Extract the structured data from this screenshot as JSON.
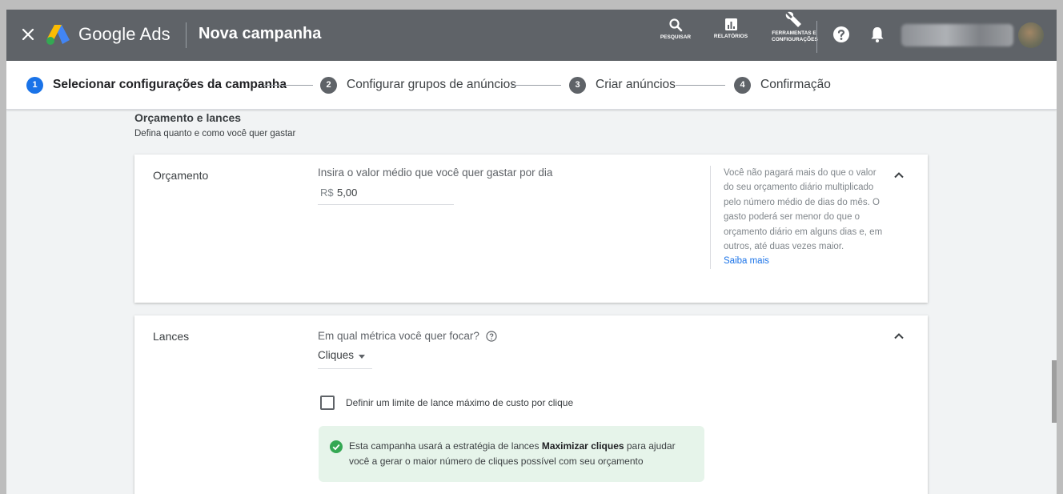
{
  "header": {
    "brand": "Google Ads",
    "title": "Nova campanha",
    "tools": [
      {
        "label": "PESQUISAR",
        "icon": "search-icon"
      },
      {
        "label": "RELATÓRIOS",
        "icon": "reports-icon"
      },
      {
        "label": "FERRAMENTAS E CONFIGURAÇÕES",
        "icon": "wrench-icon"
      }
    ],
    "colors": {
      "bar": "#5f6368",
      "text": "#ffffff"
    }
  },
  "stepper": {
    "steps": [
      {
        "num": "1",
        "label": "Selecionar configurações da campanha",
        "active": true
      },
      {
        "num": "2",
        "label": "Configurar grupos de anúncios",
        "active": false
      },
      {
        "num": "3",
        "label": "Criar anúncios",
        "active": false
      },
      {
        "num": "4",
        "label": "Confirmação",
        "active": false
      }
    ],
    "active_color": "#1a73e8"
  },
  "section": {
    "title": "Orçamento e lances",
    "subtitle": "Defina quanto e como você quer gastar"
  },
  "budget": {
    "title": "Orçamento",
    "question": "Insira o valor médio que você quer gastar por dia",
    "currency": "R$",
    "value": "5,00",
    "help": "Você não pagará mais do que o valor do seu orçamento diário multiplicado pelo número médio de dias do mês. O gasto poderá ser menor do que o orçamento diário em alguns dias e, em outros, até duas vezes maior.",
    "help_link": "Saiba mais"
  },
  "bids": {
    "title": "Lances",
    "question": "Em qual métrica você quer focar?",
    "selected": "Cliques",
    "checkbox_label": "Definir um limite de lance máximo de custo por clique",
    "checkbox_checked": false,
    "note_before": "Esta campanha usará a estratégia de lances ",
    "note_bold": "Maximizar cliques",
    "note_after": " para ajudar você a gerar o maior número de cliques possível com seu orçamento",
    "note_color": "#e6f4ea",
    "ok_color": "#34a853"
  }
}
